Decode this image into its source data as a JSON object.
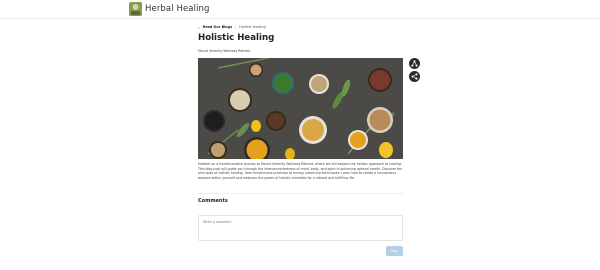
{
  "header": {
    "brand": "Herbal Healing"
  },
  "breadcrumb": {
    "items": [
      "Read Our Blogs",
      "Holistic Healing"
    ]
  },
  "post": {
    "title": "Holistic Healing",
    "author": "Mount Serenity Wellness Retreat",
    "image_alt": "Bowls of herbs, spices, seeds, oils and lemons on a dark table",
    "body": "Embark on a transformative journey to Mount Serenity Wellness Retreat, where we will explore the holistic approach to healing. This blog post will guide you through the interconnectedness of mind, body, and spirit in achieving optimal health. Discover the principles of holistic healing, from mindfulness practices to energy balancing techniques. Learn how to create a harmonious balance within yourself and embrace the power of holistic remedies for a vibrant and fulfilling life."
  },
  "actions": {
    "share_icon": "share-alt-icon",
    "share2_icon": "share-network-icon"
  },
  "comments": {
    "heading": "Comments",
    "placeholder": "Write a comment",
    "post_label": "Post"
  },
  "colors": {
    "accent_button": "#b8cde6",
    "fab": "#2b2b2b",
    "hero_bg": "#4a4a48"
  }
}
